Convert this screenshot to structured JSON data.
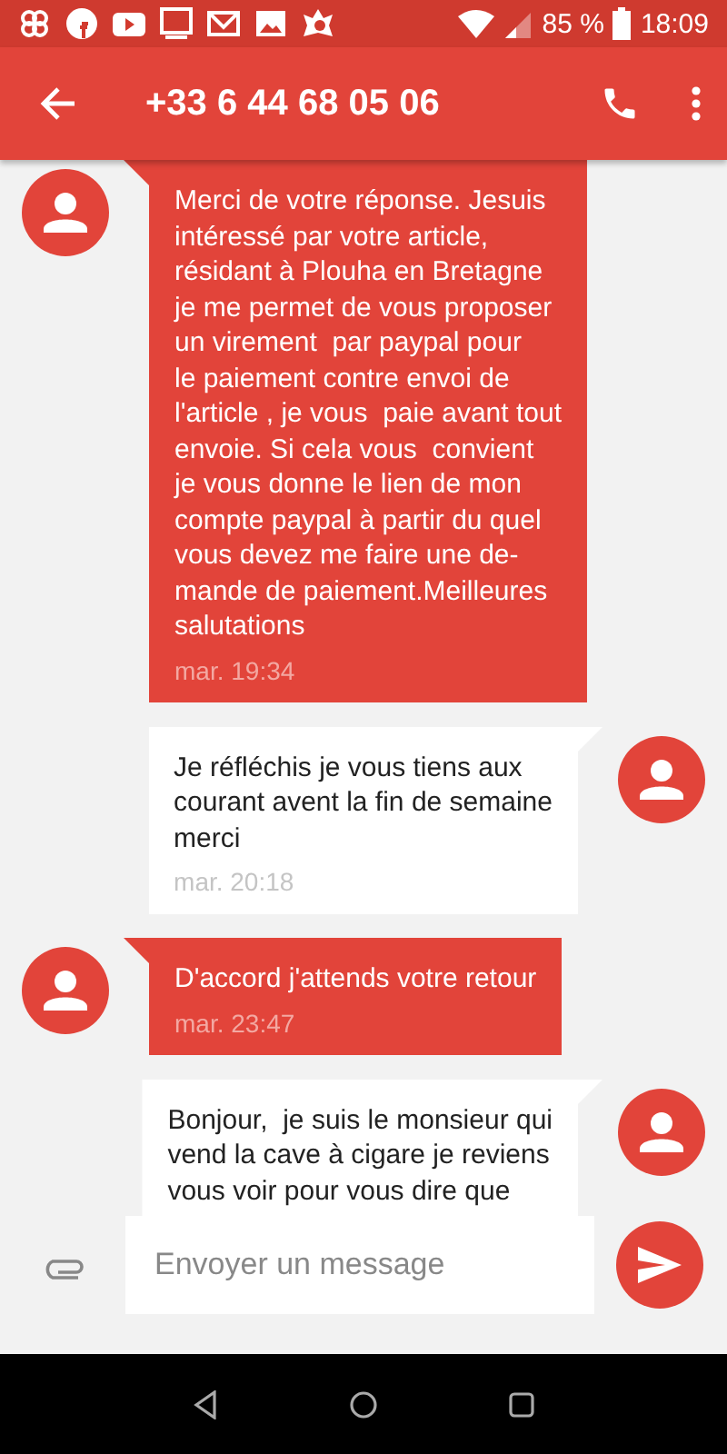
{
  "status_bar": {
    "battery": "85 %",
    "time": "18:09"
  },
  "header": {
    "title": "+33 6 44 68 05 06"
  },
  "messages": [
    {
      "kind": "incoming",
      "text": "Merci de votre réponse. Jesuis\nintéressé par votre article,\nrésidant à Plouha en Bretagne\nje me permet de vous proposer\nun virement  par paypal pour\nle paiement contre envoi de\nl'article , je vous  paie avant tout\nenvoie. Si cela vous  convient\nje vous donne le lien de mon\ncompte paypal à partir du quel\nvous devez me faire une de-\nmande de paiement.Meilleures\nsalutations",
      "time": "mar. 19:34"
    },
    {
      "kind": "outgoing",
      "text": "Je réfléchis je vous tiens aux\ncourant avent la fin de semaine\nmerci",
      "time": "mar. 20:18"
    },
    {
      "kind": "incoming",
      "text": "D'accord j'attends votre retour",
      "time": "mar. 23:47"
    },
    {
      "kind": "outgoing",
      "text": "Bonjour,  je suis le monsieur qui\nvend la cave à cigare je reviens\nvous voir pour vous dire que"
    }
  ],
  "composer": {
    "placeholder": "Envoyer un message"
  }
}
